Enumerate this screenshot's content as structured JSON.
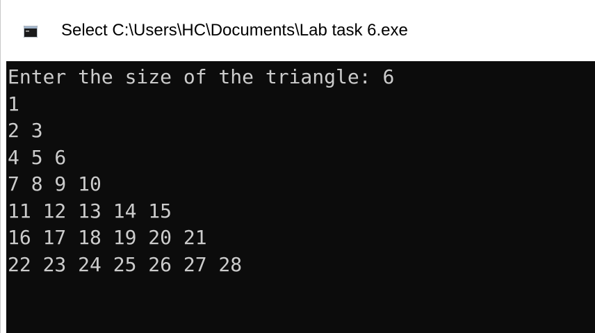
{
  "window": {
    "title": "Select C:\\Users\\HC\\Documents\\Lab task 6.exe",
    "icon": "console-app-icon"
  },
  "console": {
    "background": "#0c0c0c",
    "foreground": "#cccccc",
    "lines": [
      "Enter the size of the triangle: 6",
      "1",
      "2 3",
      "4 5 6",
      "7 8 9 10",
      "11 12 13 14 15",
      "16 17 18 19 20 21",
      "22 23 24 25 26 27 28"
    ]
  }
}
